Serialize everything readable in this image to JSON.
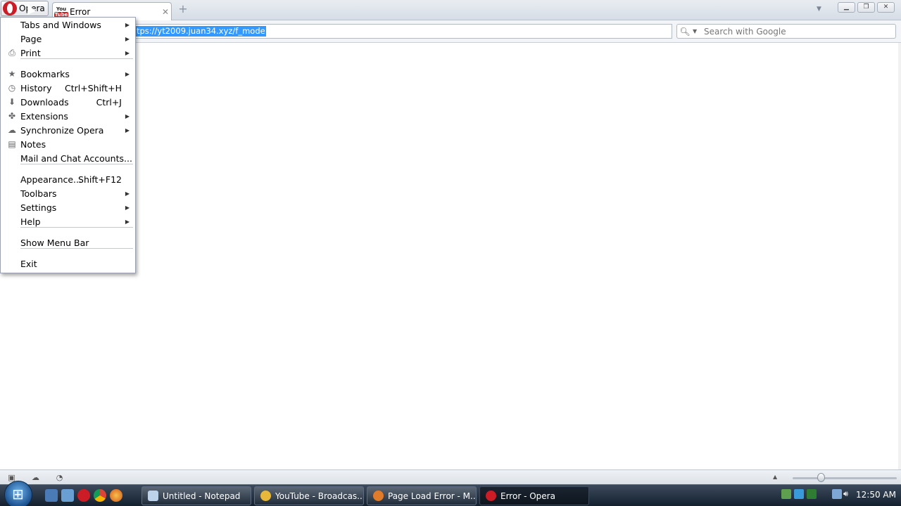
{
  "window": {
    "opera_button_label": "Opera",
    "tab": {
      "title": "Error",
      "favicon_top": "You",
      "favicon_bottom": "Tube"
    }
  },
  "toolbar": {
    "address_url": "tps://yt2009.juan34.xyz/f_mode",
    "search_placeholder": "Search with Google"
  },
  "menu": {
    "items": [
      {
        "label": "Tabs and Windows",
        "icon": "none",
        "shortcut": "",
        "submenu": true
      },
      {
        "label": "Page",
        "icon": "none",
        "shortcut": "",
        "submenu": true
      },
      {
        "label": "Print",
        "icon": "printer-icon",
        "shortcut": "",
        "submenu": true
      },
      {
        "label": "Bookmarks",
        "icon": "star-icon",
        "shortcut": "",
        "submenu": true
      },
      {
        "label": "History",
        "icon": "clock-icon",
        "shortcut": "Ctrl+Shift+H",
        "submenu": false
      },
      {
        "label": "Downloads",
        "icon": "download-icon",
        "shortcut": "Ctrl+J",
        "submenu": false
      },
      {
        "label": "Extensions",
        "icon": "puzzle-icon",
        "shortcut": "",
        "submenu": true
      },
      {
        "label": "Synchronize Opera",
        "icon": "cloud-icon",
        "shortcut": "",
        "submenu": true
      },
      {
        "label": "Notes",
        "icon": "notes-icon",
        "shortcut": "",
        "submenu": false
      },
      {
        "label": "Mail and Chat Accounts...",
        "icon": "none",
        "shortcut": "",
        "submenu": false
      },
      {
        "label": "Appearance...",
        "icon": "none",
        "shortcut": "Shift+F12",
        "submenu": false
      },
      {
        "label": "Toolbars",
        "icon": "none",
        "shortcut": "",
        "submenu": true
      },
      {
        "label": "Settings",
        "icon": "none",
        "shortcut": "",
        "submenu": true
      },
      {
        "label": "Help",
        "icon": "none",
        "shortcut": "",
        "submenu": true
      },
      {
        "label": "Show Menu Bar",
        "icon": "none",
        "shortcut": "",
        "submenu": false
      },
      {
        "label": "Exit",
        "icon": "none",
        "shortcut": "",
        "submenu": false
      }
    ]
  },
  "taskbar": {
    "tasks": [
      {
        "label": "Untitled - Notepad",
        "color": "#bcd3ea"
      },
      {
        "label": "YouTube - Broadcas...",
        "color": "#e8b83a"
      },
      {
        "label": "Page Load Error - M...",
        "color": "#e07b2a"
      },
      {
        "label": "Error - Opera",
        "color": "#cc1c25"
      }
    ],
    "clock": "12:50 AM"
  },
  "colors": {
    "selection": "#3399ff",
    "opera_red": "#cc1c25"
  }
}
